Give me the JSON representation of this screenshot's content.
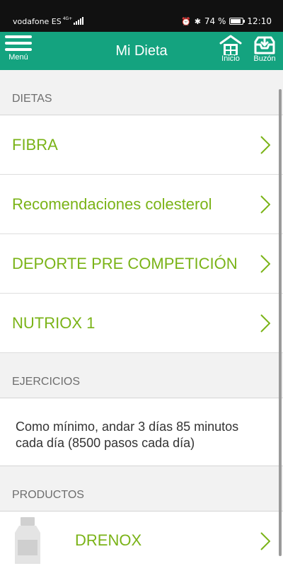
{
  "status_bar": {
    "carrier": "vodafone ES",
    "network": "4G+",
    "battery": "74 %",
    "time": "12:10",
    "icons": [
      "alarm-icon",
      "bluetooth-icon",
      "battery-icon"
    ]
  },
  "app_bar": {
    "menu_label": "Menú",
    "title": "Mi Dieta",
    "inicio_label": "Inicio",
    "buzon_label": "Buzón",
    "color": "#14a37f"
  },
  "sections": {
    "dietas": {
      "header": "DIETAS",
      "items": [
        {
          "label": "FIBRA"
        },
        {
          "label": "Recomendaciones colesterol"
        },
        {
          "label": "DEPORTE PRE COMPETICIÓN"
        },
        {
          "label": "NUTRIOX 1"
        }
      ]
    },
    "ejercicios": {
      "header": "EJERCICIOS",
      "text": "Como mínimo, andar 3 días 85 minutos cada día (8500 pasos cada día)"
    },
    "productos": {
      "header": "PRODUCTOS",
      "items": [
        {
          "label": "DRENOX",
          "icon": "bottle-icon"
        }
      ]
    }
  },
  "colors": {
    "accent": "#7ab317",
    "header_text": "#6e6e6e"
  }
}
